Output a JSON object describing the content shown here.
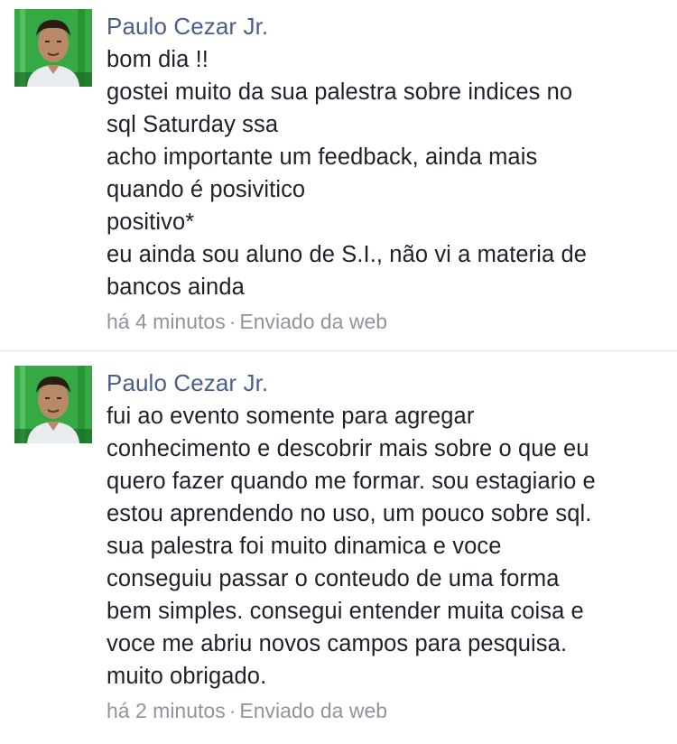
{
  "messages": [
    {
      "author": "Paulo Cezar Jr.",
      "avatar": "profile-photo",
      "lines": [
        "bom dia !!",
        "gostei muito da sua palestra sobre indices no",
        "sql Saturday ssa",
        "acho importante um feedback, ainda mais",
        "quando é posivitico",
        "positivo*",
        "eu ainda sou aluno de S.I., não vi a materia de",
        "bancos ainda"
      ],
      "time": "há 4 minutos",
      "separator": "·",
      "source": "Enviado da web"
    },
    {
      "author": "Paulo Cezar Jr.",
      "avatar": "profile-photo",
      "lines": [
        "fui ao evento somente para agregar",
        "conhecimento e descobrir mais sobre o que eu",
        "quero fazer quando me formar. sou estagiario e",
        "estou aprendendo no uso, um pouco sobre sql.",
        "sua palestra foi muito dinamica e voce",
        "conseguiu passar o conteudo de uma forma",
        "bem simples. consegui entender muita coisa e",
        "voce me abriu novos campos para pesquisa.",
        "muito obrigado."
      ],
      "time": "há 2 minutos",
      "separator": "·",
      "source": "Enviado da web"
    }
  ],
  "colors": {
    "author": "#4b5e8a",
    "text": "#1d2129",
    "meta": "#90949c",
    "divider": "#dddfe2",
    "avatar_bg": "#2f9e3a"
  }
}
